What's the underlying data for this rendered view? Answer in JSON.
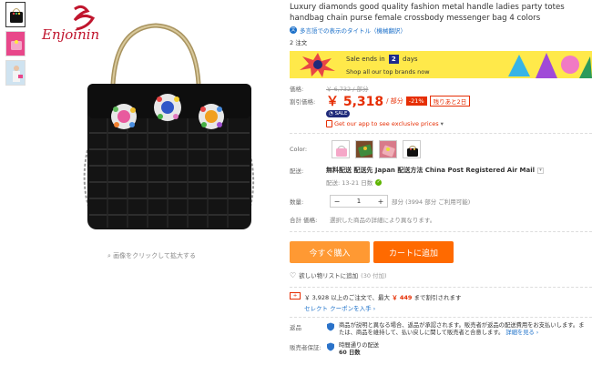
{
  "product": {
    "title": "Luxury diamonds good quality fashion metal handle ladies party totes handbag chain purse female crossbody messenger bag 4 colors",
    "translate_label": "多言語での表示のタイトル（機械翻訳）",
    "orders": "2 注文",
    "brand_logo_text": "Enjoinin",
    "zoom_hint": "画像をクリックして拡大する"
  },
  "promo": {
    "sale_ends_prefix": "Sale ends in",
    "days_value": "2",
    "days_label": "days",
    "brands_text": "Shop all our top brands now"
  },
  "pricing": {
    "original_label": "価格:",
    "original_price": "￥ 6,732 / 部分",
    "discount_label": "割引価格:",
    "price": "￥ 5,318",
    "unit": "/ 部分",
    "discount": "-21%",
    "days_left": "残りあと2日",
    "sale_badge": "SALE",
    "app_coupon": "Get our app to see exclusive prices"
  },
  "options": {
    "color_label": "Color:",
    "shipping_label": "配送:",
    "shipping_text": "無料配送 配送先 Japan 配送方法 China Post Registered Air Mail",
    "delivery_text": "配送: 13-21 日数",
    "qty_label": "数量:",
    "qty_minus": "−",
    "qty_value": "1",
    "qty_plus": "+",
    "qty_available": "部分 (3994 部分 ご利用可能)",
    "total_label": "合計 価格:",
    "total_text": "選択した商品の詳細により異なります。"
  },
  "actions": {
    "buy_now": "今すぐ購入",
    "add_to_cart": "カートに追加",
    "wishlist": "欲しい物リストに追加",
    "wishlist_count": "(30 付加)"
  },
  "coupon": {
    "icon": "+",
    "text_prefix": "￥ 3,928 以上のご注文で、最大",
    "amount": "￥ 449",
    "text_suffix": "まで割引されます",
    "link": "セレクト クーポンを入手 ›"
  },
  "returns": {
    "label": "返品",
    "text": "商品が説明と異なる場合、返品が承認されます。販売者が返品の配送費用をお支払いします。または、商品を維持して、払い戻しに関して販売者と合意します。",
    "link": "詳細を見る ›"
  },
  "guarantee": {
    "label": "販売者保証:",
    "line1": "時間通りの配送",
    "line2": "60 日数"
  },
  "colors": {
    "accent_red": "#e62e04",
    "buy_orange": "#ff9933",
    "cart_orange": "#ff6a00",
    "promo_yellow": "#ffe94a",
    "link_blue": "#1a6fc9"
  }
}
